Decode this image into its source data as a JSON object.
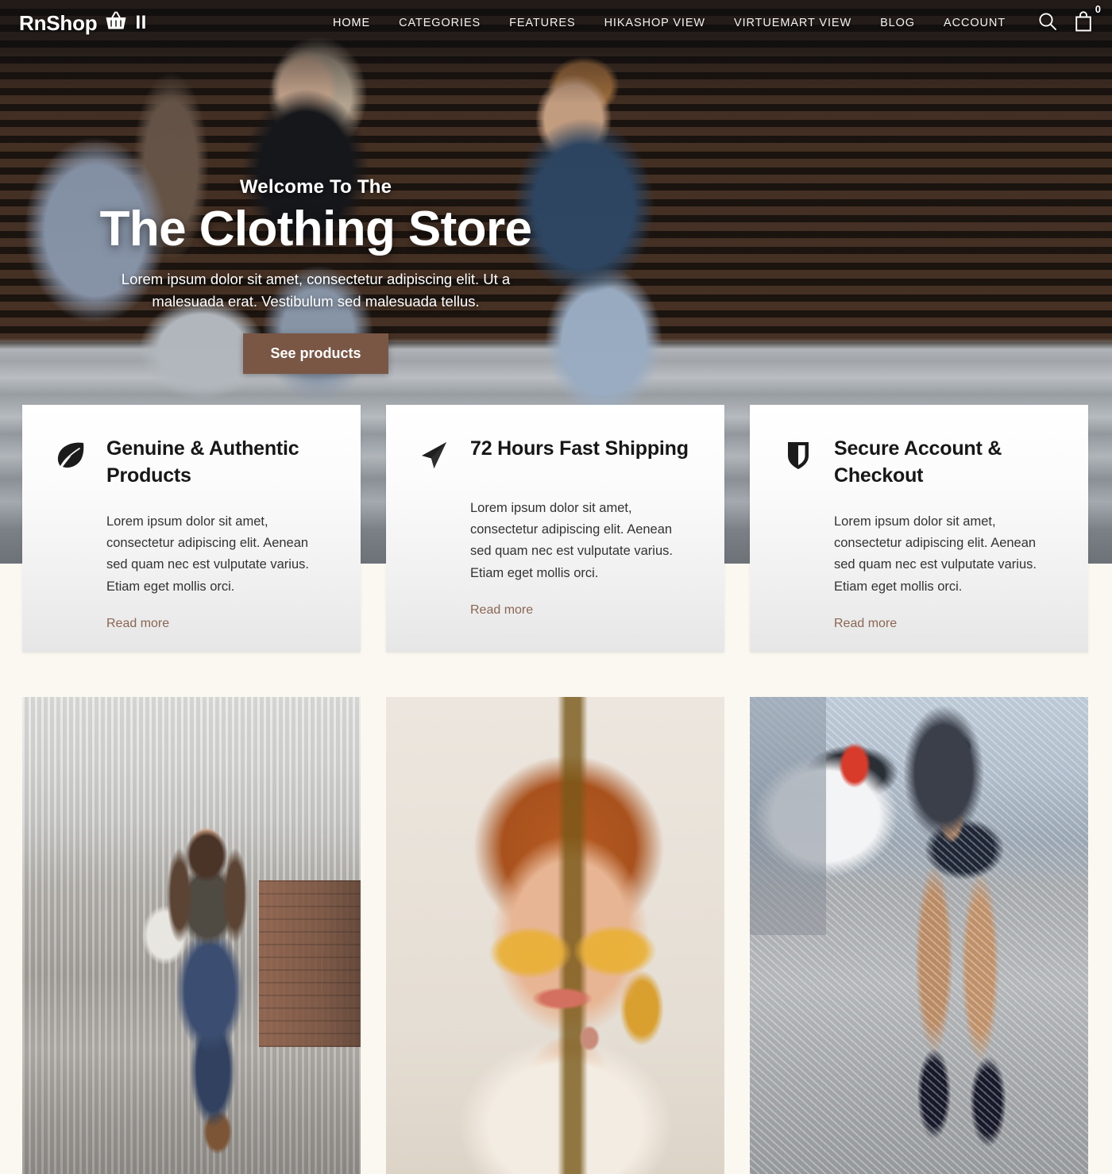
{
  "header": {
    "brand_name": "RnShop",
    "brand_mark": "II",
    "basket_icon": "shopping-basket-icon",
    "nav": [
      {
        "label": "HOME",
        "active": true
      },
      {
        "label": "CATEGORIES",
        "active": false
      },
      {
        "label": "FEATURES",
        "active": false
      },
      {
        "label": "HIKASHOP VIEW",
        "active": false
      },
      {
        "label": "VIRTUEMART VIEW",
        "active": false
      },
      {
        "label": "BLOG",
        "active": false
      },
      {
        "label": "ACCOUNT",
        "active": false
      }
    ],
    "search_icon": "search-icon",
    "cart_icon": "shopping-bag-icon",
    "cart_count": "0"
  },
  "hero": {
    "eyebrow": "Welcome To The",
    "title": "The Clothing Store",
    "subtitle": "Lorem ipsum dolor sit amet, consectetur adipiscing elit. Ut a malesuada erat. Vestibulum sed malesuada tellus.",
    "cta_label": "See products",
    "cta_color": "#7a5745"
  },
  "features": {
    "cards": [
      {
        "icon": "leaf-icon",
        "title": "Genuine & Authentic Products",
        "text": "Lorem ipsum dolor sit amet, consectetur adipiscing elit. Aenean sed quam nec est vulputate varius. Etiam eget mollis orci.",
        "link_label": "Read more"
      },
      {
        "icon": "paper-plane-icon",
        "title": "72 Hours Fast Shipping",
        "text": "Lorem ipsum dolor sit amet, consectetur adipiscing elit. Aenean sed quam nec est vulputate varius. Etiam eget mollis orci.",
        "link_label": "Read more"
      },
      {
        "icon": "shield-icon",
        "title": "Secure Account & Checkout",
        "text": "Lorem ipsum dolor sit amet, consectetur adipiscing elit. Aenean sed quam nec est vulputate varius. Etiam eget mollis orci.",
        "link_label": "Read more"
      }
    ],
    "link_color": "#8a6652"
  },
  "gallery": {
    "items": [
      {
        "name": "product-photo-tote-bag"
      },
      {
        "name": "product-photo-sunglasses"
      },
      {
        "name": "product-photo-handbag-heels"
      }
    ]
  },
  "theme": {
    "page_background": "#fbf8f1",
    "accent_brown": "#7a5745",
    "text_dark": "#171717",
    "text_body": "#333333"
  }
}
